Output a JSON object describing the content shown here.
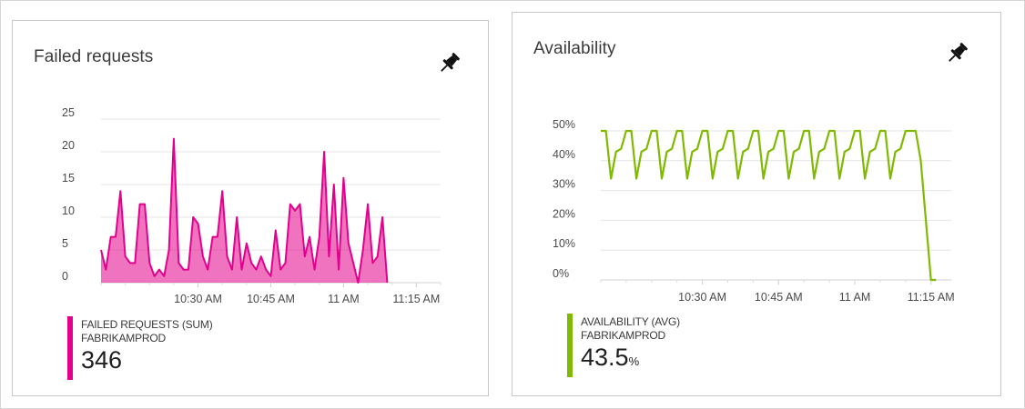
{
  "tiles": {
    "failed": {
      "title": "Failed requests",
      "pin_icon": "pin-icon",
      "legend": {
        "metric": "FAILED REQUESTS (SUM)",
        "resource": "FABRIKAMPROD",
        "value": "346",
        "unit": "",
        "color": "#e3008c"
      }
    },
    "availability": {
      "title": "Availability",
      "pin_icon": "pin-icon",
      "legend": {
        "metric": "AVAILABILITY (AVG)",
        "resource": "FABRIKAMPROD",
        "value": "43.5",
        "unit": "%",
        "color": "#7fba00"
      }
    }
  },
  "chart_data": [
    {
      "type": "area",
      "title": "",
      "xlabel": "",
      "ylabel": "",
      "ylim": [
        0,
        25
      ],
      "y_ticks": [
        "0",
        "5",
        "10",
        "15",
        "20",
        "25"
      ],
      "x_ticks": [
        {
          "t": 10,
          "label": "10:30 AM"
        },
        {
          "t": 25,
          "label": "10:45 AM"
        },
        {
          "t": 40,
          "label": "11 AM"
        },
        {
          "t": 55,
          "label": "11:15 AM"
        }
      ],
      "xlim": [
        -10,
        60
      ],
      "grid": true,
      "color": "#e3008c",
      "series": [
        {
          "values": [
            [
              -10,
              5
            ],
            [
              -9,
              2
            ],
            [
              -8,
              7
            ],
            [
              -7,
              7
            ],
            [
              -6,
              14
            ],
            [
              -5,
              4
            ],
            [
              -4,
              3
            ],
            [
              -3,
              3
            ],
            [
              -2,
              12
            ],
            [
              -1,
              12
            ],
            [
              0,
              3
            ],
            [
              1,
              1
            ],
            [
              2,
              2
            ],
            [
              3,
              1
            ],
            [
              4,
              5
            ],
            [
              5,
              22
            ],
            [
              6,
              3
            ],
            [
              7,
              2
            ],
            [
              8,
              2
            ],
            [
              9,
              10
            ],
            [
              10,
              9
            ],
            [
              11,
              4
            ],
            [
              12,
              2
            ],
            [
              13,
              7
            ],
            [
              14,
              7
            ],
            [
              15,
              14
            ],
            [
              16,
              4
            ],
            [
              17,
              2
            ],
            [
              18,
              10
            ],
            [
              19,
              2
            ],
            [
              20,
              6
            ],
            [
              21,
              3
            ],
            [
              22,
              2
            ],
            [
              23,
              4
            ],
            [
              24,
              2
            ],
            [
              25,
              1
            ],
            [
              26,
              8
            ],
            [
              27,
              2
            ],
            [
              28,
              3
            ],
            [
              29,
              12
            ],
            [
              30,
              11
            ],
            [
              31,
              12
            ],
            [
              32,
              4
            ],
            [
              33,
              7
            ],
            [
              34,
              2
            ],
            [
              35,
              7
            ],
            [
              36,
              20
            ],
            [
              37,
              4
            ],
            [
              38,
              15
            ],
            [
              39,
              2
            ],
            [
              40,
              16
            ],
            [
              41,
              6
            ],
            [
              42,
              3
            ],
            [
              43,
              0
            ],
            [
              44,
              5
            ],
            [
              45,
              12
            ],
            [
              46,
              3
            ],
            [
              47,
              4
            ],
            [
              48,
              10
            ],
            [
              49,
              0
            ]
          ]
        }
      ]
    },
    {
      "type": "line",
      "title": "",
      "xlabel": "",
      "ylabel": "",
      "ylim": [
        0,
        50
      ],
      "y_ticks": [
        "0%",
        "10%",
        "20%",
        "30%",
        "40%",
        "50%"
      ],
      "x_ticks": [
        {
          "t": 10,
          "label": "10:30 AM"
        },
        {
          "t": 25,
          "label": "10:45 AM"
        },
        {
          "t": 40,
          "label": "11 AM"
        },
        {
          "t": 55,
          "label": "11:15 AM"
        }
      ],
      "xlim": [
        -10,
        59
      ],
      "grid": true,
      "color": "#7fba00",
      "series": [
        {
          "values": [
            [
              -10,
              50
            ],
            [
              -9,
              50
            ],
            [
              -8,
              34
            ],
            [
              -7,
              43
            ],
            [
              -6,
              44
            ],
            [
              -5,
              50
            ],
            [
              -4,
              50
            ],
            [
              -3,
              34
            ],
            [
              -2,
              43
            ],
            [
              -1,
              44
            ],
            [
              0,
              50
            ],
            [
              1,
              50
            ],
            [
              2,
              34
            ],
            [
              3,
              43
            ],
            [
              4,
              44
            ],
            [
              5,
              50
            ],
            [
              6,
              50
            ],
            [
              7,
              34
            ],
            [
              8,
              43
            ],
            [
              9,
              44
            ],
            [
              10,
              50
            ],
            [
              11,
              50
            ],
            [
              12,
              34
            ],
            [
              13,
              43
            ],
            [
              14,
              44
            ],
            [
              15,
              50
            ],
            [
              16,
              50
            ],
            [
              17,
              34
            ],
            [
              18,
              43
            ],
            [
              19,
              44
            ],
            [
              20,
              50
            ],
            [
              21,
              50
            ],
            [
              22,
              34
            ],
            [
              23,
              43
            ],
            [
              24,
              44
            ],
            [
              25,
              50
            ],
            [
              26,
              50
            ],
            [
              27,
              34
            ],
            [
              28,
              43
            ],
            [
              29,
              44
            ],
            [
              30,
              50
            ],
            [
              31,
              50
            ],
            [
              32,
              34
            ],
            [
              33,
              43
            ],
            [
              34,
              44
            ],
            [
              35,
              50
            ],
            [
              36,
              50
            ],
            [
              37,
              34
            ],
            [
              38,
              43
            ],
            [
              39,
              44
            ],
            [
              40,
              50
            ],
            [
              41,
              50
            ],
            [
              42,
              34
            ],
            [
              43,
              43
            ],
            [
              44,
              44
            ],
            [
              45,
              50
            ],
            [
              46,
              50
            ],
            [
              47,
              34
            ],
            [
              48,
              43
            ],
            [
              49,
              44
            ],
            [
              50,
              50
            ],
            [
              51,
              50
            ],
            [
              52,
              50
            ],
            [
              53,
              40
            ],
            [
              54,
              20
            ],
            [
              55,
              0
            ],
            [
              56,
              0
            ]
          ]
        }
      ]
    }
  ]
}
